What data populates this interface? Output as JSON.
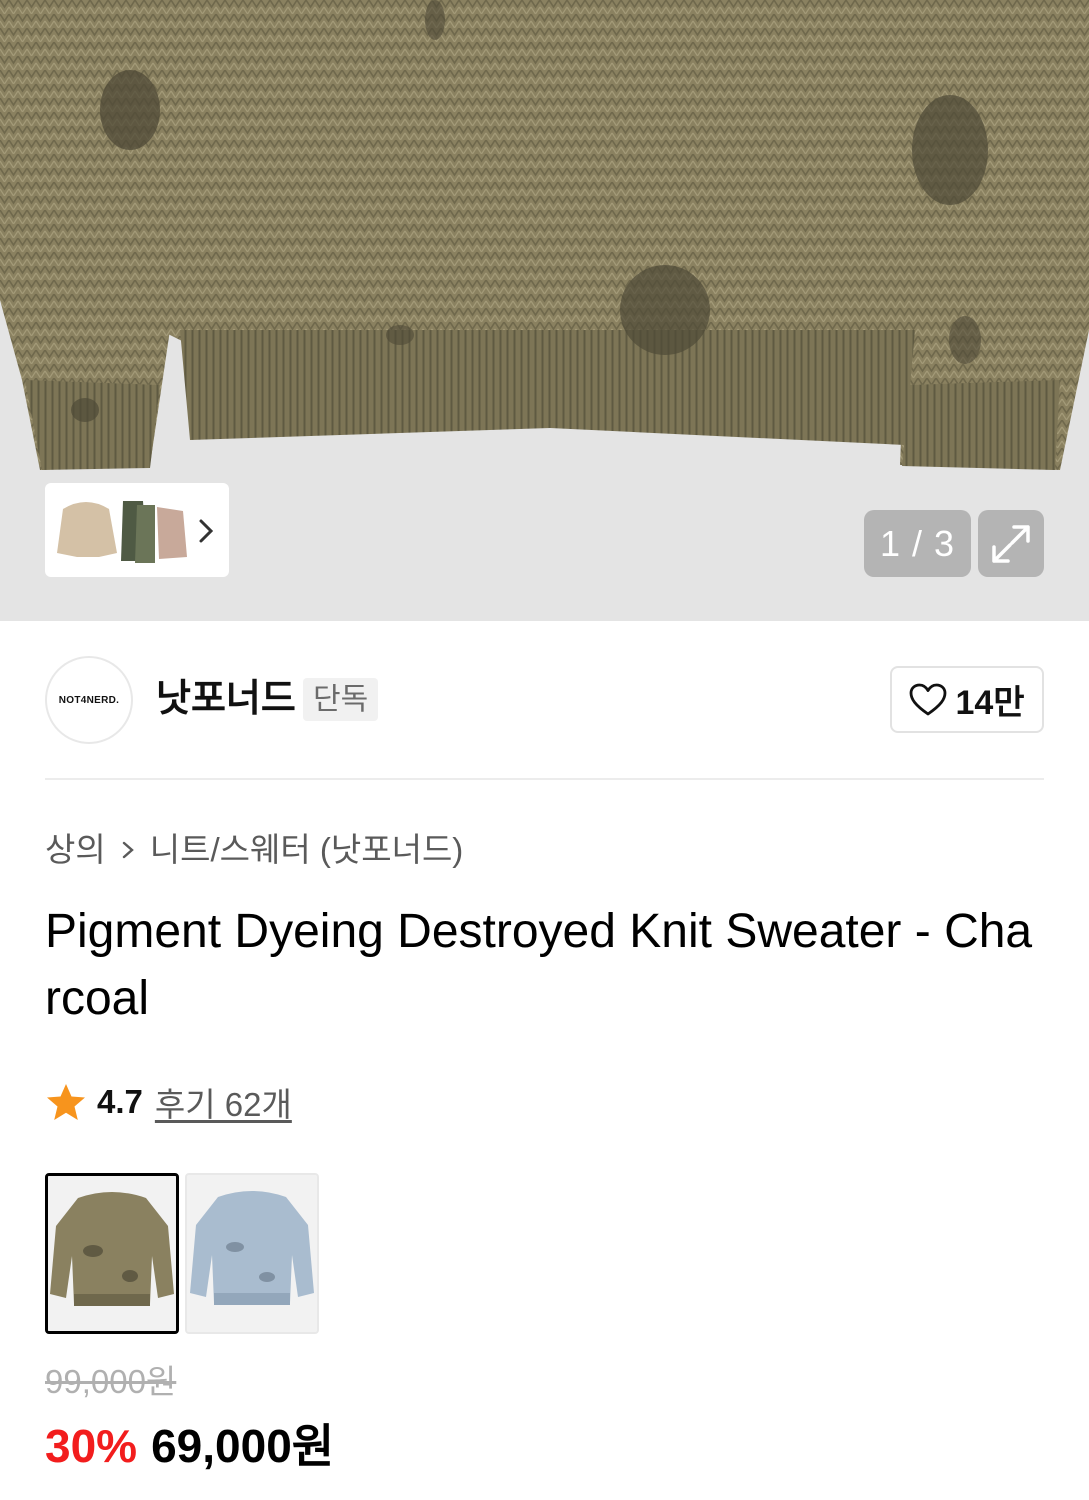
{
  "gallery": {
    "counter": "1 / 3",
    "colors": {
      "sweater": "#8a8160",
      "sweater_dark": "#5f5a42",
      "background": "#e4e4e4"
    }
  },
  "brand": {
    "logo_text": "NOT4NERD.",
    "name": "낫포너드",
    "badge": "단독",
    "likes": "14만"
  },
  "breadcrumb": {
    "category": "상의",
    "subcategory": "니트/스웨터 (낫포너드)"
  },
  "product": {
    "title": "Pigment Dyeing Destroyed Knit Sweater - Charcoal",
    "rating": "4.7",
    "review_link": "후기 62개",
    "star_color": "#f7941d",
    "color_options": [
      {
        "name": "charcoal",
        "selected": true,
        "color": "#8a8160"
      },
      {
        "name": "blue",
        "selected": false,
        "color": "#a9bccf"
      }
    ]
  },
  "price": {
    "original": "99,000원",
    "discount": "30%",
    "sale": "69,000원",
    "discount_color": "#f21d1d"
  }
}
